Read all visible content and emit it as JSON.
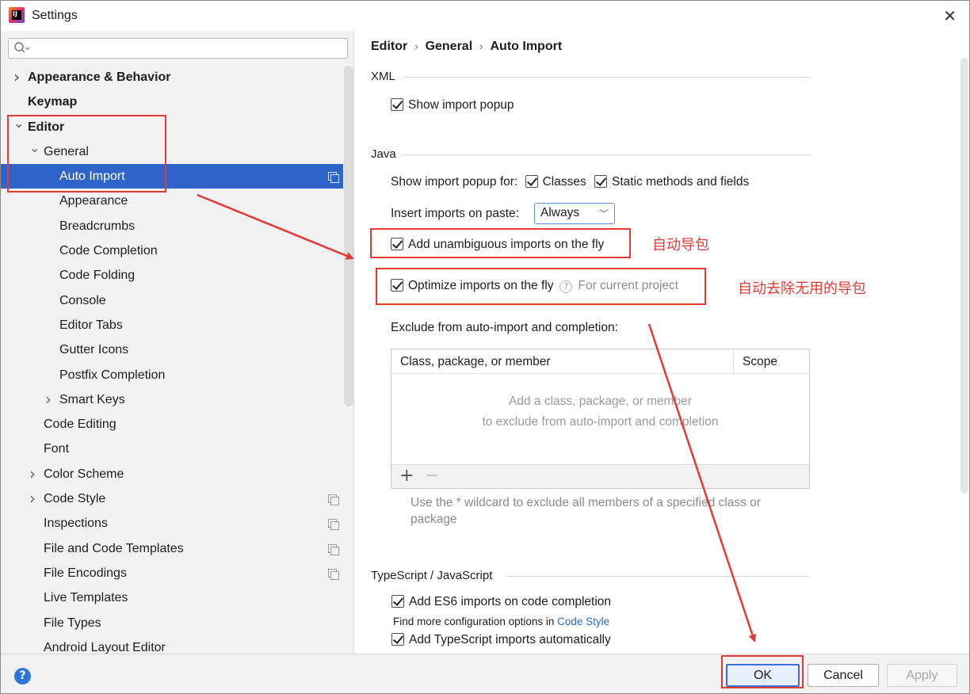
{
  "window": {
    "title": "Settings"
  },
  "sidebar": {
    "search_placeholder": "",
    "items": [
      {
        "label": "Appearance & Behavior",
        "bold": true,
        "chev": "right"
      },
      {
        "label": "Keymap",
        "bold": true
      },
      {
        "label": "Editor",
        "bold": true,
        "chev": "down"
      },
      {
        "label": "General",
        "chev": "down"
      },
      {
        "label": "Auto Import",
        "selected": true,
        "copy": true
      },
      {
        "label": "Appearance"
      },
      {
        "label": "Breadcrumbs"
      },
      {
        "label": "Code Completion"
      },
      {
        "label": "Code Folding"
      },
      {
        "label": "Console"
      },
      {
        "label": "Editor Tabs"
      },
      {
        "label": "Gutter Icons"
      },
      {
        "label": "Postfix Completion"
      },
      {
        "label": "Smart Keys",
        "chev": "right"
      },
      {
        "label": "Code Editing"
      },
      {
        "label": "Font"
      },
      {
        "label": "Color Scheme",
        "chev": "right"
      },
      {
        "label": "Code Style",
        "chev": "right",
        "copy": true
      },
      {
        "label": "Inspections",
        "copy": true
      },
      {
        "label": "File and Code Templates",
        "copy": true
      },
      {
        "label": "File Encodings",
        "copy": true
      },
      {
        "label": "Live Templates"
      },
      {
        "label": "File Types"
      },
      {
        "label": "Android Layout Editor"
      }
    ]
  },
  "breadcrumb": {
    "part1": "Editor",
    "part2": "General",
    "part3": "Auto Import",
    "sep": "›"
  },
  "xml": {
    "title": "XML",
    "show_import_popup": "Show import popup"
  },
  "java": {
    "title": "Java",
    "popup_for_label": "Show import popup for:",
    "classes": "Classes",
    "static_methods": "Static methods and fields",
    "insert_on_paste_label": "Insert imports on paste:",
    "insert_on_paste_value": "Always",
    "add_unambiguous": "Add unambiguous imports on the fly",
    "optimize_imports": "Optimize imports on the fly",
    "optimize_scope_hint": "For current project",
    "exclude_label": "Exclude from auto-import and completion:",
    "table": {
      "col1": "Class, package, or member",
      "col2": "Scope",
      "empty_line1": "Add a class, package, or member",
      "empty_line2": "to exclude from auto-import and completion",
      "add": "+",
      "remove": "−"
    },
    "wildcard_note": "Use the * wildcard to exclude all members of a specified class or package"
  },
  "ts": {
    "title": "TypeScript / JavaScript",
    "add_es6": "Add ES6 imports on code completion",
    "find_more_prefix": "Find more configuration options in",
    "find_more_link": "Code Style",
    "add_ts": "Add TypeScript imports automatically"
  },
  "annotations": {
    "auto_import": "自动导包",
    "auto_remove": "自动去除无用的导包"
  },
  "buttons": {
    "help": "?",
    "ok": "OK",
    "cancel": "Cancel",
    "apply": "Apply"
  },
  "colors": {
    "selection": "#2f65ca",
    "annotation_red": "#e53935",
    "link": "#2a6bc9"
  }
}
